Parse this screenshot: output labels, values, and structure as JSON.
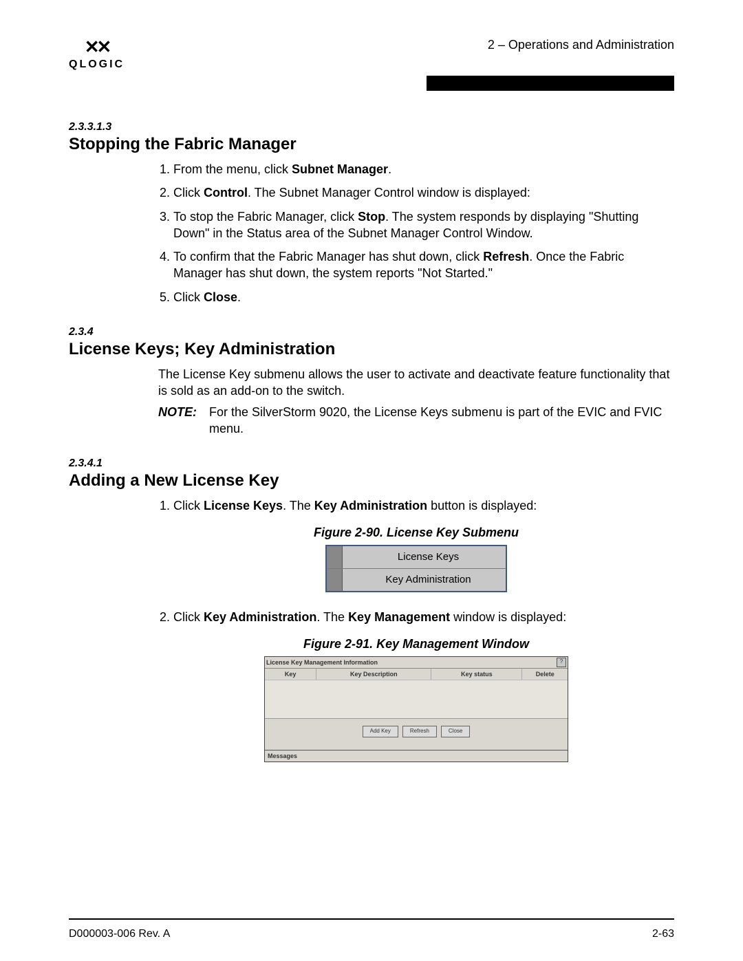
{
  "header": {
    "logo_text": "QLOGIC",
    "chapter_label": "2 – Operations and Administration"
  },
  "section1": {
    "number": "2.3.3.1.3",
    "title": "Stopping the Fabric Manager",
    "steps": {
      "s1_a": "From the menu, click ",
      "s1_b": "Subnet Manager",
      "s1_c": ".",
      "s2_a": "Click ",
      "s2_b": "Control",
      "s2_c": ". The Subnet Manager Control window is displayed:",
      "s3_a": "To stop the Fabric Manager, click ",
      "s3_b": "Stop",
      "s3_c": ". The system responds by displaying \"Shutting Down\" in the Status area of the Subnet Manager Control Window.",
      "s4_a": "To confirm that the Fabric Manager has shut down, click ",
      "s4_b": "Refresh",
      "s4_c": ". Once the Fabric Manager has shut down, the system reports \"Not Started.\"",
      "s5_a": "Click ",
      "s5_b": "Close",
      "s5_c": "."
    }
  },
  "section2": {
    "number": "2.3.4",
    "title": "License Keys; Key Administration",
    "intro": "The License Key submenu allows the user to activate and deactivate feature functionality that is sold as an add-on to the switch.",
    "note_label": "NOTE:",
    "note_text": "For the SilverStorm 9020, the License Keys submenu is part of the EVIC and FVIC menu."
  },
  "section3": {
    "number": "2.3.4.1",
    "title": "Adding a New License Key",
    "step1_a": "Click ",
    "step1_b": "License Keys",
    "step1_c": ". The ",
    "step1_d": "Key Administration",
    "step1_e": " button is displayed:",
    "fig90_caption": "Figure 2-90. License Key Submenu",
    "fig90": {
      "row1": "License Keys",
      "row2": "Key Administration"
    },
    "step2_a": "Click ",
    "step2_b": "Key Administration",
    "step2_c": ". The ",
    "step2_d": "Key Management",
    "step2_e": " window is displayed:",
    "fig91_caption": "Figure 2-91. Key Management Window",
    "fig91": {
      "title": "License Key Management Information",
      "close_glyph": "?",
      "col_key": "Key",
      "col_desc": "Key Description",
      "col_status": "Key status",
      "col_delete": "Delete",
      "btn_add": "Add Key",
      "btn_refresh": "Refresh",
      "btn_close": "Close",
      "messages_label": "Messages"
    }
  },
  "footer": {
    "left": "D000003-006 Rev. A",
    "right": "2-63"
  }
}
